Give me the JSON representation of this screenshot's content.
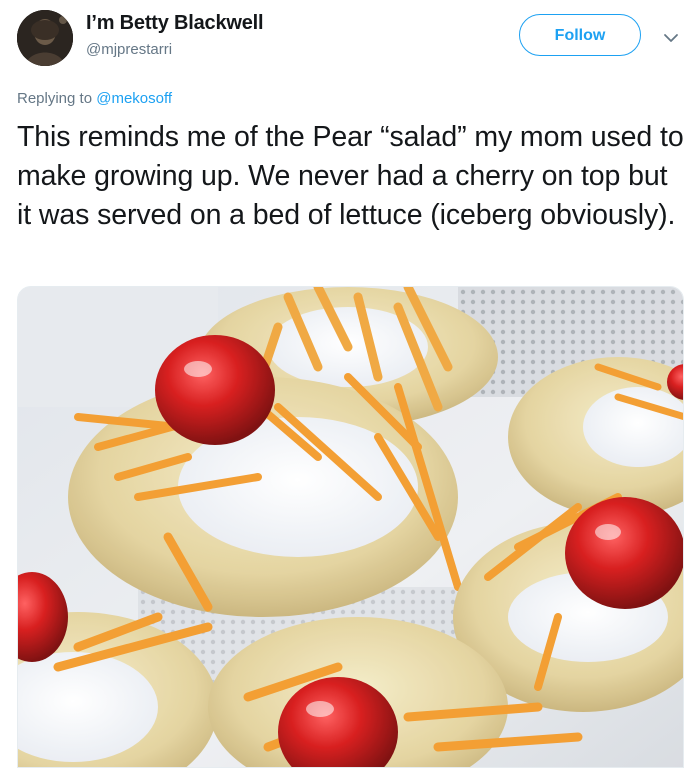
{
  "tweet": {
    "author": {
      "display_name": "I’m Betty Blackwell",
      "handle": "@mjprestarri"
    },
    "follow_label": "Follow",
    "reply_prefix": "Replying to",
    "reply_to": "@mekosoff",
    "text": "This reminds me of the Pear “salad” my mom used to make growing up. We never had a cherry on top but it was served on a bed of lettuce (iceberg obviously).",
    "media": {
      "kind": "photo",
      "subject": "pear halves topped with cream cheese, shredded cheddar and maraschino cherries"
    }
  },
  "icons": {
    "more": "chevron-down-icon"
  },
  "colors": {
    "accent": "#1da1f2",
    "text": "#14171a",
    "muted": "#657786"
  }
}
